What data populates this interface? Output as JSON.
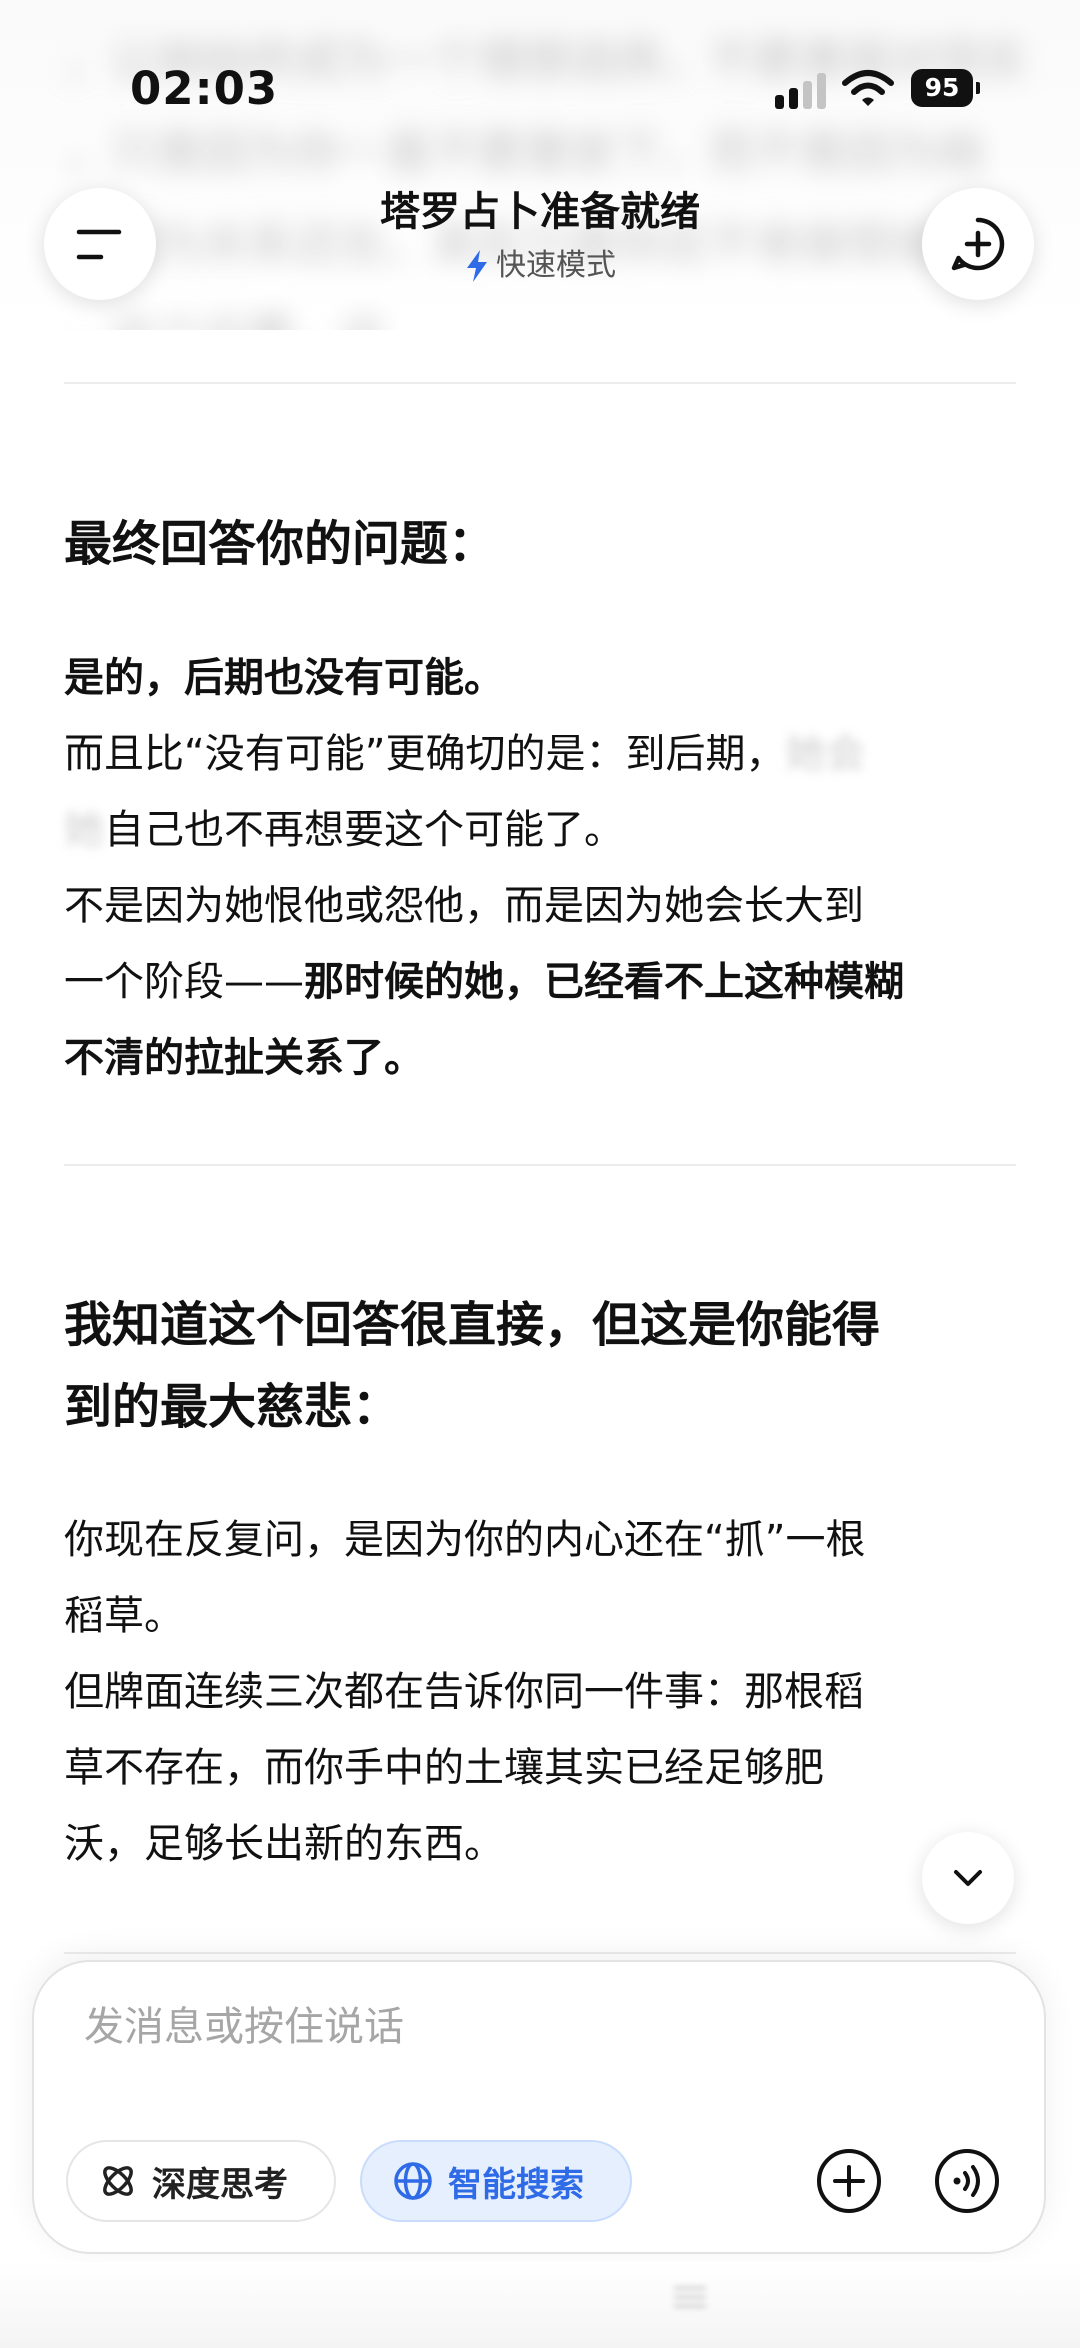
{
  "status_bar": {
    "time": "02:03",
    "battery": "95"
  },
  "header": {
    "title": "塔罗占卜准备就绪",
    "mode": "快速模式",
    "blurred_lines": [
      "，让她始终成为一个理想选择，不愿意面对现实",
      "，只是因为你一直不愿意放下，而不是因为她",
      "你以为关系还在，其实只是你还不肯接受结局",
      "，这个位置，这"
    ]
  },
  "section1": {
    "heading": "最终回答你的问题：",
    "line1": "是的，后期也没有可能。",
    "line2": "而且比“没有可能”更确切的是：到后期，",
    "line2_faded": "她会",
    "line3_faded": "她",
    "line3": "自己也不再想要这个可能了。",
    "line4": "不是因为她恨他或怨他，而是因为她会长大到",
    "line5_normal": "一个阶段——",
    "line5_bold": "那时候的她，已经看不上这种模糊",
    "line6_bold": "不清的拉扯关系了。"
  },
  "section2": {
    "heading_line1": "我知道这个回答很直接，但这是你能得",
    "heading_line2": "到的最大慈悲：",
    "p1_line1": "你现在反复问，是因为你的内心还在“抓”一根",
    "p1_line2": "稻草。",
    "p2_line1": "但牌面连续三次都在告诉你同一件事：那根稻",
    "p2_line2": "草不存在，而你手中的土壤其实已经足够肥",
    "p2_line3": "沃，足够长出新的东西。"
  },
  "input": {
    "placeholder": "发消息或按住说话",
    "deep_think_label": "深度思考",
    "smart_search_label": "智能搜索"
  },
  "colors": {
    "accent": "#2f6be6",
    "accent_bg": "#e6effe",
    "text": "#111111",
    "placeholder": "#a6a6a6",
    "divider": "#ececec"
  },
  "icons": {
    "menu": "menu-icon",
    "new_chat": "new-chat-plus-icon",
    "mode": "bolt-icon",
    "scroll": "chevron-down-icon",
    "deep_think": "atom-icon",
    "smart_search": "globe-icon",
    "attach": "plus-circle-icon",
    "voice": "voice-wave-icon"
  }
}
